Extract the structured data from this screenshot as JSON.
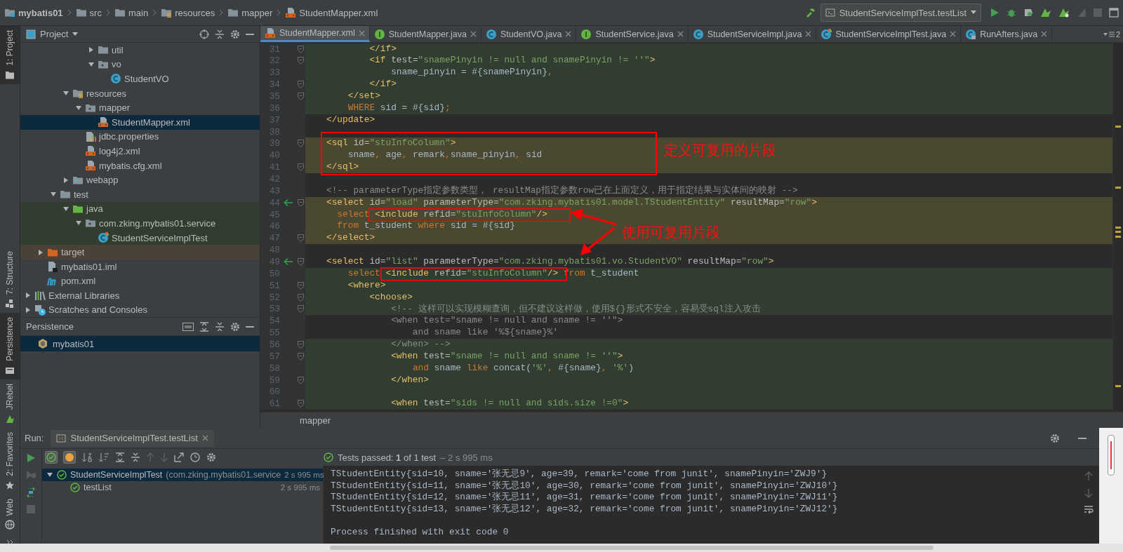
{
  "navbar": {
    "breadcrumbs": [
      {
        "label": "mybatis01",
        "kind": "module"
      },
      {
        "label": "src",
        "kind": "folder"
      },
      {
        "label": "main",
        "kind": "folder"
      },
      {
        "label": "resources",
        "kind": "resources-folder"
      },
      {
        "label": "mapper",
        "kind": "folder"
      },
      {
        "label": "StudentMapper.xml",
        "kind": "xml"
      }
    ],
    "run_config": "StudentServiceImplTest.testList"
  },
  "tool_windows": [
    {
      "label": "1: Project",
      "kind": "folder",
      "selected": true
    },
    {
      "label": "7: Structure",
      "kind": "structure",
      "selected": false
    },
    {
      "label": "Persistence",
      "kind": "persistence",
      "selected": true
    },
    {
      "label": "JRebel",
      "kind": "jrebel",
      "selected": false
    }
  ],
  "project": {
    "title": "Project",
    "tree": [
      {
        "children": [
          {
            "children": [
              {
                "children": [
                  {
                    "children": [
                      {
                        "children": [
                          {
                            "label": "util",
                            "kind": "folder",
                            "expanded": false,
                            "selected": false,
                            "test_source": false,
                            "excluded": false
                          },
                          {
                            "label": "vo",
                            "kind": "package",
                            "expanded": true,
                            "selected": false,
                            "test_source": false,
                            "excluded": false,
                            "children": [
                              {
                                "label": "StudentVO",
                                "kind": "class",
                                "selected": false,
                                "test_source": false,
                                "excluded": false
                              }
                            ]
                          }
                        ]
                      }
                    ]
                  },
                  {
                    "label": "resources",
                    "kind": "resources-folder",
                    "expanded": true,
                    "selected": false,
                    "test_source": false,
                    "excluded": false,
                    "children": [
                      {
                        "label": "mapper",
                        "kind": "package",
                        "expanded": true,
                        "selected": false,
                        "test_source": false,
                        "excluded": false,
                        "children": [
                          {
                            "label": "StudentMapper.xml",
                            "kind": "xml",
                            "selected": true,
                            "test_source": false,
                            "excluded": false
                          }
                        ]
                      },
                      {
                        "label": "jdbc.properties",
                        "kind": "properties",
                        "selected": false,
                        "test_source": false,
                        "excluded": false
                      },
                      {
                        "label": "log4j2.xml",
                        "kind": "xml",
                        "selected": false,
                        "test_source": false,
                        "excluded": false
                      },
                      {
                        "label": "mybatis.cfg.xml",
                        "kind": "xml",
                        "selected": false,
                        "test_source": false,
                        "excluded": false
                      }
                    ]
                  },
                  {
                    "label": "webapp",
                    "kind": "web-folder",
                    "expanded": false,
                    "selected": false,
                    "test_source": false,
                    "excluded": false
                  }
                ]
              },
              {
                "label": "test",
                "kind": "folder",
                "expanded": true,
                "selected": false,
                "test_source": false,
                "excluded": false,
                "children": [
                  {
                    "label": "java",
                    "kind": "test-folder",
                    "expanded": true,
                    "selected": false,
                    "test_source": true,
                    "excluded": false,
                    "children": [
                      {
                        "label": "com.zking.mybatis01.service",
                        "kind": "package",
                        "expanded": true,
                        "selected": false,
                        "test_source": true,
                        "excluded": false,
                        "children": [
                          {
                            "label": "StudentServiceImplTest",
                            "kind": "test-class",
                            "selected": false,
                            "test_source": true,
                            "excluded": false
                          }
                        ]
                      }
                    ]
                  }
                ]
              }
            ]
          },
          {
            "label": "target",
            "kind": "excluded-folder",
            "expanded": false,
            "selected": false,
            "test_source": false,
            "excluded": true
          },
          {
            "label": "mybatis01.iml",
            "kind": "iml",
            "selected": false,
            "test_source": false,
            "excluded": false
          },
          {
            "label": "pom.xml",
            "kind": "maven",
            "selected": false,
            "test_source": false,
            "excluded": false
          }
        ]
      },
      {
        "label": "External Libraries",
        "kind": "libraries",
        "expanded": false,
        "selected": false,
        "test_source": false,
        "excluded": false
      },
      {
        "label": "Scratches and Consoles",
        "kind": "scratches",
        "expanded": false,
        "selected": false,
        "test_source": false,
        "excluded": false
      }
    ]
  },
  "persistence": {
    "title": "Persistence",
    "items": [
      {
        "label": "mybatis01",
        "selected": true
      }
    ]
  },
  "editor": {
    "tabs": [
      {
        "label": "StudentMapper.xml",
        "kind": "xml",
        "selected": true
      },
      {
        "label": "StudentMapper.java",
        "kind": "interface",
        "selected": false
      },
      {
        "label": "StudentVO.java",
        "kind": "class",
        "selected": false
      },
      {
        "label": "StudentService.java",
        "kind": "interface",
        "selected": false
      },
      {
        "label": "StudentServiceImpl.java",
        "kind": "class",
        "selected": false
      },
      {
        "label": "StudentServiceImplTest.java",
        "kind": "test-class",
        "selected": false
      },
      {
        "label": "RunAfters.java",
        "kind": "locked-class",
        "selected": false
      }
    ],
    "overflow_count": "2",
    "lines": [
      {
        "number": "31",
        "kind": "code",
        "injected": true,
        "highlighted": false,
        "fold": true,
        "gutter_mark": false,
        "text": "        </if>"
      },
      {
        "number": "32",
        "kind": "code",
        "injected": true,
        "highlighted": false,
        "fold": true,
        "gutter_mark": false,
        "text": "        <if test=\"snamePinyin != null and snamePinyin != ''\">"
      },
      {
        "number": "33",
        "kind": "code",
        "injected": true,
        "highlighted": false,
        "fold": false,
        "gutter_mark": false,
        "text": "            sname_pinyin = #{snamePinyin},"
      },
      {
        "number": "34",
        "kind": "code",
        "injected": true,
        "highlighted": false,
        "fold": true,
        "gutter_mark": false,
        "text": "        </if>"
      },
      {
        "number": "35",
        "kind": "code",
        "injected": true,
        "highlighted": false,
        "fold": true,
        "gutter_mark": false,
        "text": "    </set>"
      },
      {
        "number": "36",
        "kind": "code",
        "injected": true,
        "highlighted": false,
        "fold": false,
        "gutter_mark": false,
        "text": "    WHERE sid = #{sid};"
      },
      {
        "number": "37",
        "kind": "code",
        "injected": false,
        "highlighted": false,
        "fold": false,
        "gutter_mark": false,
        "text": "</update>"
      },
      {
        "number": "38",
        "injected": false,
        "highlighted": false,
        "fold": false,
        "gutter_mark": false
      },
      {
        "number": "39",
        "kind": "code",
        "injected": false,
        "highlighted": true,
        "fold": true,
        "gutter_mark": false,
        "text": "<sql id=\"stuInfoColumn\">"
      },
      {
        "number": "40",
        "kind": "code",
        "injected": false,
        "highlighted": true,
        "fold": false,
        "gutter_mark": false,
        "text": "    sname, age, remark,sname_pinyin, sid"
      },
      {
        "number": "41",
        "kind": "code",
        "injected": false,
        "highlighted": true,
        "fold": true,
        "gutter_mark": false,
        "text": "</sql>"
      },
      {
        "number": "42",
        "injected": false,
        "highlighted": false,
        "fold": false,
        "gutter_mark": false
      },
      {
        "number": "43",
        "kind": "comment",
        "injected": false,
        "highlighted": false,
        "fold": false,
        "gutter_mark": false,
        "text": "<!-- parameterType指定参数类型， resultMap指定参数row已在上面定义，用于指定结果与实体间的映射 -->"
      },
      {
        "number": "44",
        "kind": "code",
        "injected": false,
        "highlighted": true,
        "fold": true,
        "gutter_mark": true,
        "text": "<select id=\"load\" parameterType=\"com.zking.mybatis01.model.TStudentEntity\" resultMap=\"row\">"
      },
      {
        "number": "45",
        "kind": "code",
        "injected": false,
        "highlighted": true,
        "fold": false,
        "gutter_mark": false,
        "text": "  select <include refid=\"stuInfoColumn\"/>"
      },
      {
        "number": "46",
        "kind": "code",
        "injected": false,
        "highlighted": true,
        "fold": false,
        "gutter_mark": false,
        "text": "  from t_student where sid = #{sid}"
      },
      {
        "number": "47",
        "kind": "code",
        "injected": false,
        "highlighted": true,
        "fold": true,
        "gutter_mark": false,
        "text": "</select>"
      },
      {
        "number": "48",
        "injected": false,
        "highlighted": false,
        "fold": false,
        "gutter_mark": false
      },
      {
        "number": "49",
        "kind": "code",
        "injected": false,
        "highlighted": false,
        "fold": true,
        "gutter_mark": true,
        "text": "<select id=\"list\" parameterType=\"com.zking.mybatis01.vo.StudentVO\" resultMap=\"row\">"
      },
      {
        "number": "50",
        "kind": "code",
        "injected": true,
        "highlighted": false,
        "fold": false,
        "gutter_mark": false,
        "text": "    select <include refid=\"stuInfoColumn\"/> from t_student"
      },
      {
        "number": "51",
        "kind": "code",
        "injected": true,
        "highlighted": false,
        "fold": true,
        "gutter_mark": false,
        "text": "    <where>"
      },
      {
        "number": "52",
        "kind": "code",
        "injected": true,
        "highlighted": false,
        "fold": true,
        "gutter_mark": false,
        "text": "        <choose>"
      },
      {
        "number": "53",
        "kind": "comment",
        "injected": true,
        "highlighted": false,
        "fold": true,
        "gutter_mark": false,
        "text": "            <!-- 这样可以实现模糊查询，但不建议这样做，使用${}形式不安全，容易受sql注入攻击"
      },
      {
        "number": "54",
        "kind": "comment",
        "injected": false,
        "highlighted": false,
        "fold": false,
        "gutter_mark": false,
        "text": "            <when test=\"sname != null and sname != ''\">"
      },
      {
        "number": "55",
        "kind": "comment",
        "injected": false,
        "highlighted": false,
        "fold": false,
        "gutter_mark": false,
        "text": "                and sname like '%${sname}%'"
      },
      {
        "number": "56",
        "kind": "comment",
        "injected": true,
        "highlighted": false,
        "fold": true,
        "gutter_mark": false,
        "text": "            </when> -->"
      },
      {
        "number": "57",
        "kind": "code",
        "injected": true,
        "highlighted": false,
        "fold": true,
        "gutter_mark": false,
        "text": "            <when test=\"sname != null and sname != ''\">"
      },
      {
        "number": "58",
        "kind": "code",
        "injected": true,
        "highlighted": false,
        "fold": false,
        "gutter_mark": false,
        "text": "                and sname like concat('%', #{sname}, '%')"
      },
      {
        "number": "59",
        "kind": "code",
        "injected": true,
        "highlighted": false,
        "fold": true,
        "gutter_mark": false,
        "text": "            </when>"
      },
      {
        "number": "60",
        "injected": true,
        "highlighted": false,
        "fold": false,
        "gutter_mark": false
      },
      {
        "number": "61",
        "kind": "code",
        "injected": true,
        "highlighted": false,
        "fold": true,
        "gutter_mark": false,
        "text": "            <when test=\"sids != null and sids.size !=0\">"
      }
    ],
    "annotations": [
      {
        "label": "定义可复用的片段"
      },
      {
        "label": "使用可复用片段"
      }
    ],
    "breadcrumb": "mapper"
  },
  "run": {
    "title": "Run:",
    "tab": "StudentServiceImplTest.testList",
    "summary": "Tests passed: **1** of 1 test",
    "summary_time": "– 2 s 995 ms",
    "tests": [
      {
        "name": "StudentServiceImplTest",
        "package": "(com.zking.mybatis01.service",
        "duration": "2 s 995 ms",
        "passed": true,
        "expanded": true,
        "selected": true,
        "children": [
          {
            "name": "testList",
            "duration": "2 s 995 ms",
            "passed": true,
            "selected": false
          }
        ]
      }
    ],
    "output": [
      "TStudentEntity{sid=10, sname='张无忌9', age=39, remark='come from junit', snamePinyin='ZWJ9'}",
      "TStudentEntity{sid=11, sname='张无忌10', age=30, remark='come from junit', snamePinyin='ZWJ10'}",
      "TStudentEntity{sid=12, sname='张无忌11', age=31, remark='come from junit', snamePinyin='ZWJ11'}",
      "TStudentEntity{sid=13, sname='张无忌12', age=32, remark='come from junit', snamePinyin='ZWJ12'}"
    ],
    "exit_message": "Process finished with exit code 0"
  },
  "bottom_tool_windows": [
    {
      "label": "2: Favorites",
      "kind": "star",
      "selected": false
    },
    {
      "label": "Web",
      "kind": "globe",
      "selected": false
    }
  ]
}
